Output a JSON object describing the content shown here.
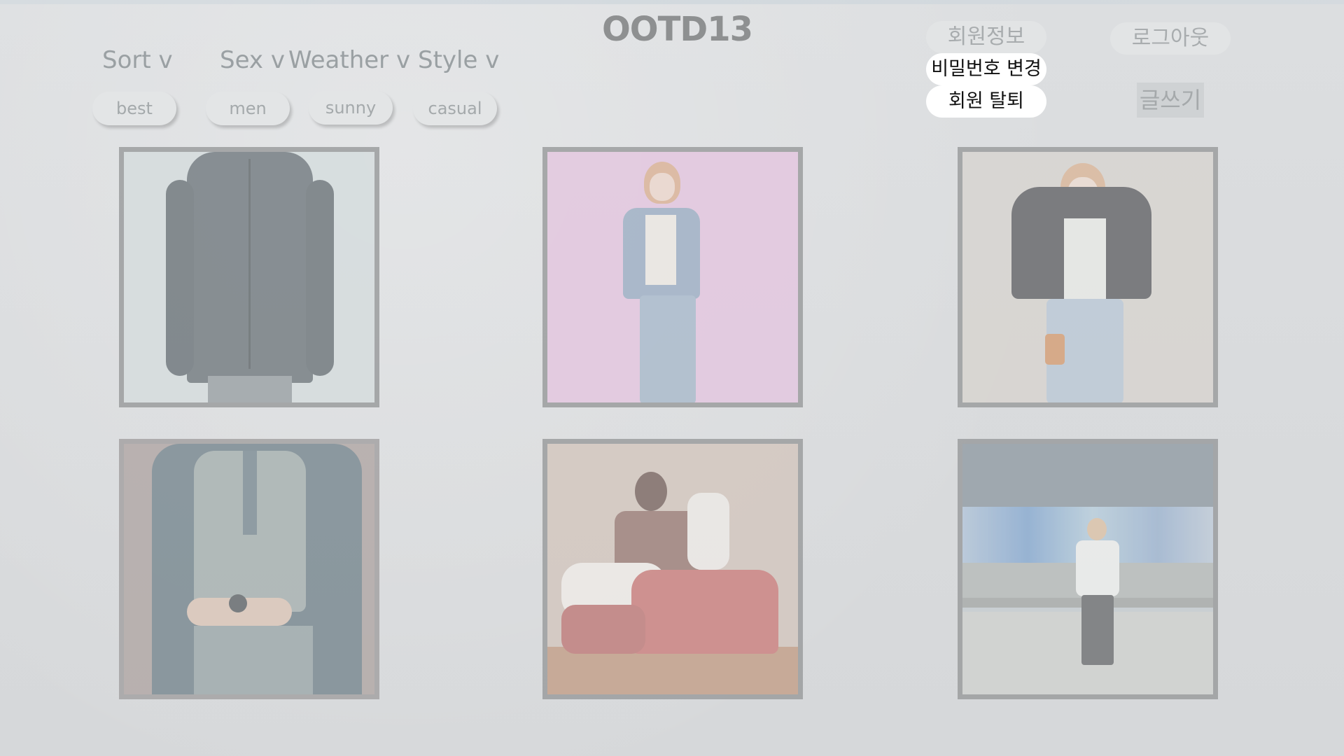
{
  "app": {
    "title": "OOTD13"
  },
  "filters": [
    {
      "label": "Sort v",
      "selected": "best"
    },
    {
      "label": "Sex v",
      "selected": "men"
    },
    {
      "label": "Weather v",
      "selected": "sunny"
    },
    {
      "label": "Style v",
      "selected": "casual"
    }
  ],
  "account": {
    "profile_label": "회원정보",
    "change_password_label": "비밀번호 변경",
    "withdraw_label": "회원 탈퇴",
    "logout_label": "로그아웃",
    "write_label": "글쓰기"
  },
  "colors": {
    "background": "#dadcde",
    "card_border": "#9c9e9f",
    "pill_active": "#ffffff",
    "muted_text": "#9aa0a3"
  },
  "posts": [
    {
      "name": "dark-zip-jacket",
      "bg": "#cfd9da"
    },
    {
      "name": "denim-jacket-pink",
      "bg": "#e5b9dd"
    },
    {
      "name": "leather-jacket",
      "bg": "#d3ccc6"
    },
    {
      "name": "grey-vest",
      "bg": "#9a8a87"
    },
    {
      "name": "red-stripe-outfit",
      "bg": "#cdb8ac"
    },
    {
      "name": "white-shirt-street",
      "bg": "#b9c2c6"
    }
  ]
}
